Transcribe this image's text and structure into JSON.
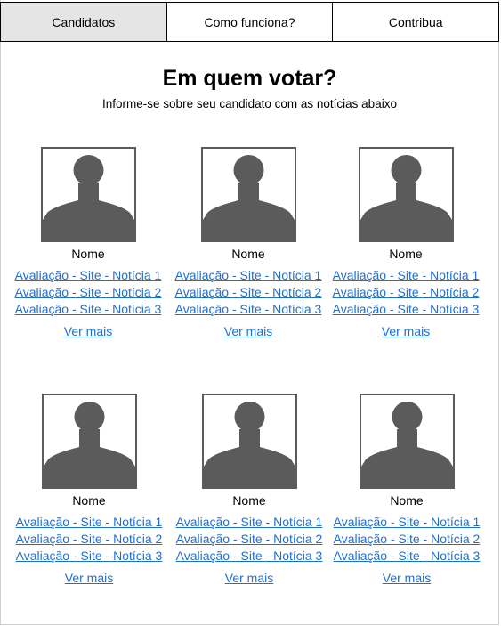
{
  "nav": {
    "tabs": [
      {
        "label": "Candidatos",
        "active": true
      },
      {
        "label": "Como funciona?",
        "active": false
      },
      {
        "label": "Contribua",
        "active": false
      }
    ]
  },
  "header": {
    "title": "Em quem votar?",
    "subtitle": "Informe-se sobre seu candidato com as notícias abaixo"
  },
  "candidates": [
    {
      "photo_icon": "person-silhouette-icon",
      "name": "Nome",
      "news": [
        "Avaliação - Site - Notícia 1",
        "Avaliação - Site - Notícia 2",
        "Avaliação - Site - Notícia 3"
      ],
      "more_label": "Ver mais"
    },
    {
      "photo_icon": "person-silhouette-icon",
      "name": "Nome",
      "news": [
        "Avaliação - Site - Notícia 1",
        "Avaliação - Site - Notícia 2",
        "Avaliação - Site - Notícia 3"
      ],
      "more_label": "Ver mais"
    },
    {
      "photo_icon": "person-silhouette-icon",
      "name": "Nome",
      "news": [
        "Avaliação - Site - Notícia 1",
        "Avaliação - Site - Notícia 2",
        "Avaliação - Site - Notícia 3"
      ],
      "more_label": "Ver mais"
    },
    {
      "photo_icon": "person-silhouette-icon",
      "name": "Nome",
      "news": [
        "Avaliação - Site - Notícia 1",
        "Avaliação - Site - Notícia 2",
        "Avaliação - Site - Notícia 3"
      ],
      "more_label": "Ver mais"
    },
    {
      "photo_icon": "person-silhouette-icon",
      "name": "Nome",
      "news": [
        "Avaliação - Site - Notícia 1",
        "Avaliação - Site - Notícia 2",
        "Avaliação - Site - Notícia 3"
      ],
      "more_label": "Ver mais"
    },
    {
      "photo_icon": "person-silhouette-icon",
      "name": "Nome",
      "news": [
        "Avaliação - Site - Notícia 1",
        "Avaliação - Site - Notícia 2",
        "Avaliação - Site - Notícia 3"
      ],
      "more_label": "Ver mais"
    }
  ],
  "colors": {
    "link": "#1f6fd1",
    "active_tab": "#e5e5e5",
    "silhouette": "#5b5b5b"
  }
}
